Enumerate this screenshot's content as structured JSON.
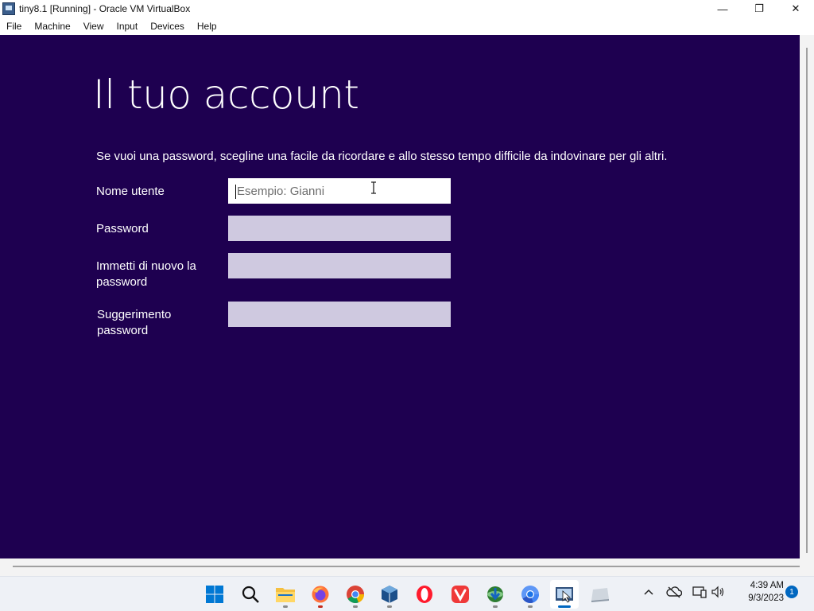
{
  "window": {
    "title": "tiny8.1 [Running] - Oracle VM VirtualBox",
    "icon": "virtualbox-vm-icon",
    "controls": {
      "minimize": "—",
      "restore": "❐",
      "close": "✕"
    }
  },
  "menubar": {
    "items": [
      "File",
      "Machine",
      "View",
      "Input",
      "Devices",
      "Help"
    ]
  },
  "setup": {
    "title": "Il tuo account",
    "intro": "Se vuoi una password, scegline una facile da ricordare e allo stesso tempo difficile da indovinare per gli altri.",
    "fields": [
      {
        "label": "Nome utente",
        "value": "",
        "placeholder": "Esempio: Gianni",
        "focused": true
      },
      {
        "label": "Password",
        "value": "",
        "placeholder": ""
      },
      {
        "label": "Immetti di nuovo la password",
        "value": "",
        "placeholder": ""
      },
      {
        "label": "Suggerimento password",
        "value": "",
        "placeholder": ""
      }
    ],
    "colors": {
      "background": "#1e0050",
      "field_inactive": "#cfc9e0",
      "field_active": "#ffffff"
    }
  },
  "taskbar": {
    "apps": [
      "windows-start-icon",
      "search-icon",
      "file-explorer-icon",
      "firefox-icon",
      "chrome-icon",
      "virtualbox-icon",
      "opera-icon",
      "vivaldi-icon",
      "internet-download-manager-icon",
      "chromium-icon",
      "virtualbox-vm-icon",
      "drive-icon"
    ],
    "tray": [
      "chevron-up-icon",
      "onedrive-offline-icon",
      "network-icon",
      "volume-icon"
    ],
    "clock": {
      "time": "4:39 AM",
      "date": "9/3/2023"
    },
    "notification_count": "1"
  }
}
